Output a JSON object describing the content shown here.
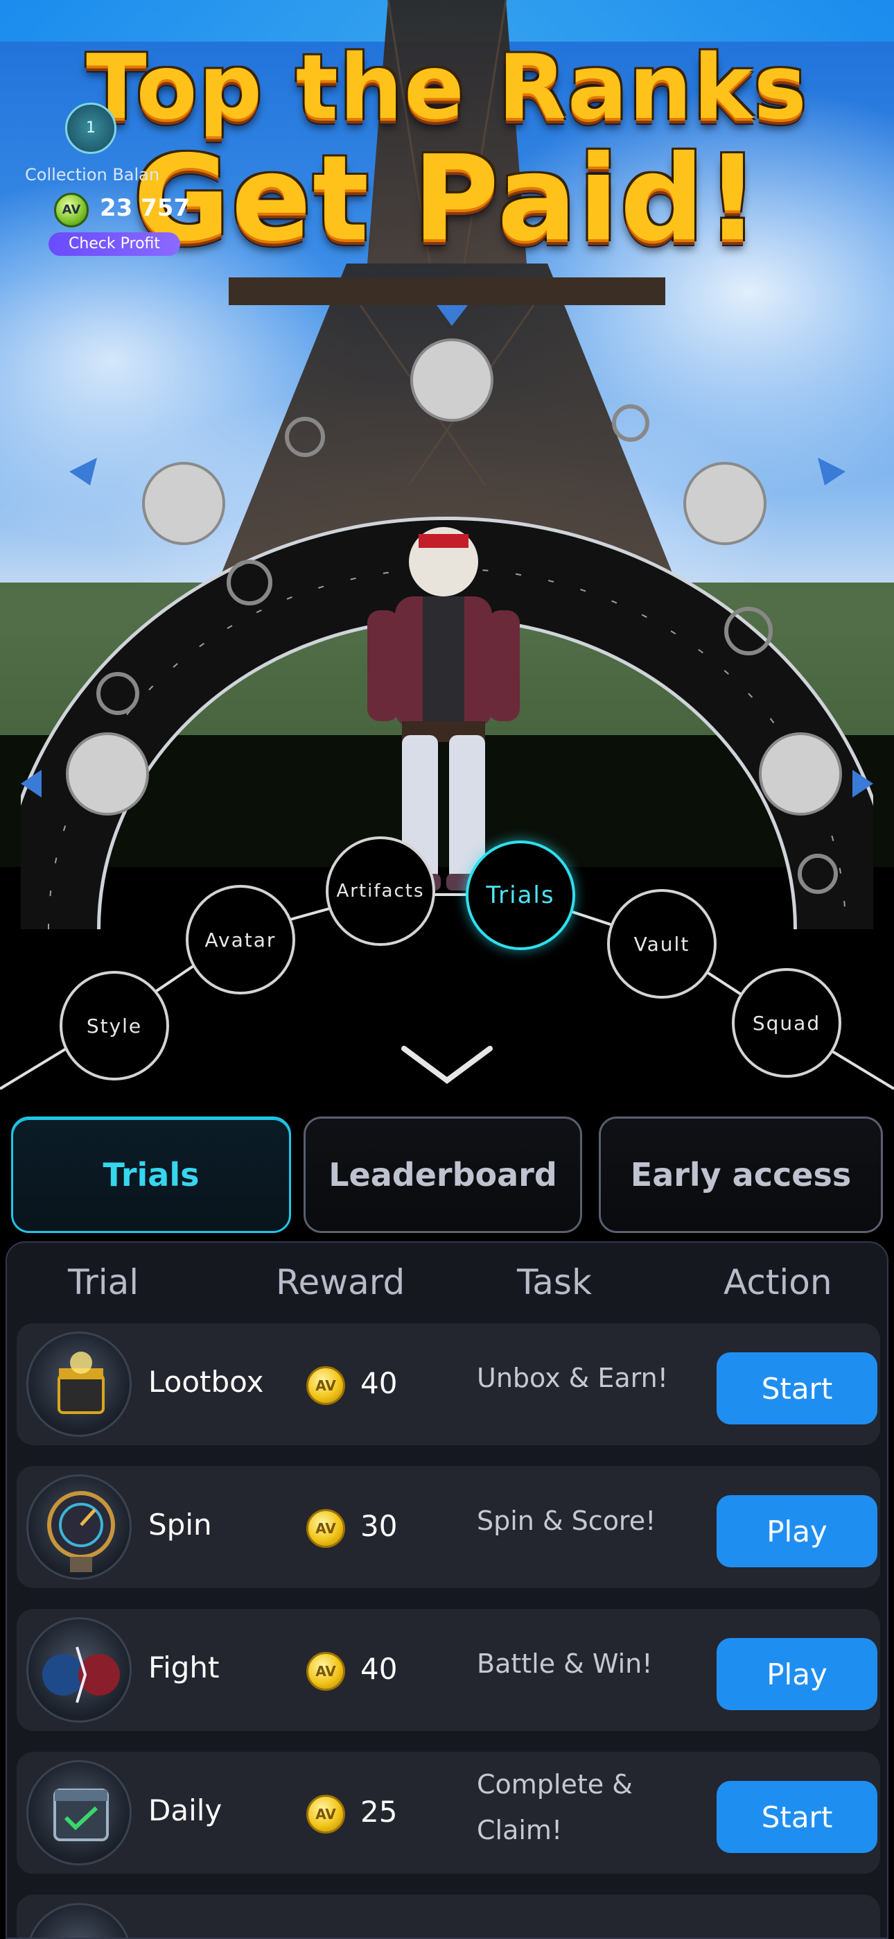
{
  "hero": {
    "title_line1": "Top the Ranks",
    "title_line2": "Get Paid!",
    "level": "1",
    "balance_label": "Collection Balan",
    "balance_value": "23 757",
    "check_profit_label": "Check Profit"
  },
  "carousel": {
    "items": [
      "Style",
      "Avatar",
      "Artifacts",
      "Trials",
      "Vault",
      "Squad"
    ],
    "active": "Trials"
  },
  "tabs": {
    "items": [
      "Trials",
      "Leaderboard",
      "Early access"
    ],
    "active": "Trials"
  },
  "table": {
    "headers": [
      "Trial",
      "Reward",
      "Task",
      "Action"
    ],
    "rows": [
      {
        "name": "Lootbox",
        "reward": "40",
        "task": "Unbox & Earn!",
        "action": "Start"
      },
      {
        "name": "Spin",
        "reward": "30",
        "task": "Spin & Score!",
        "action": "Play"
      },
      {
        "name": "Fight",
        "reward": "40",
        "task": "Battle & Win!",
        "action": "Play"
      },
      {
        "name": "Daily",
        "reward": "25",
        "task": "Complete & Claim!",
        "action": "Start"
      }
    ]
  },
  "colors": {
    "accent_cyan": "#2ee0ee",
    "action_blue": "#1f8ef1",
    "title_gold": "#ffc21a",
    "panel_bg": "#161820"
  },
  "icons": {
    "coin": "coin-icon",
    "chevron": "chevron-down-icon"
  }
}
